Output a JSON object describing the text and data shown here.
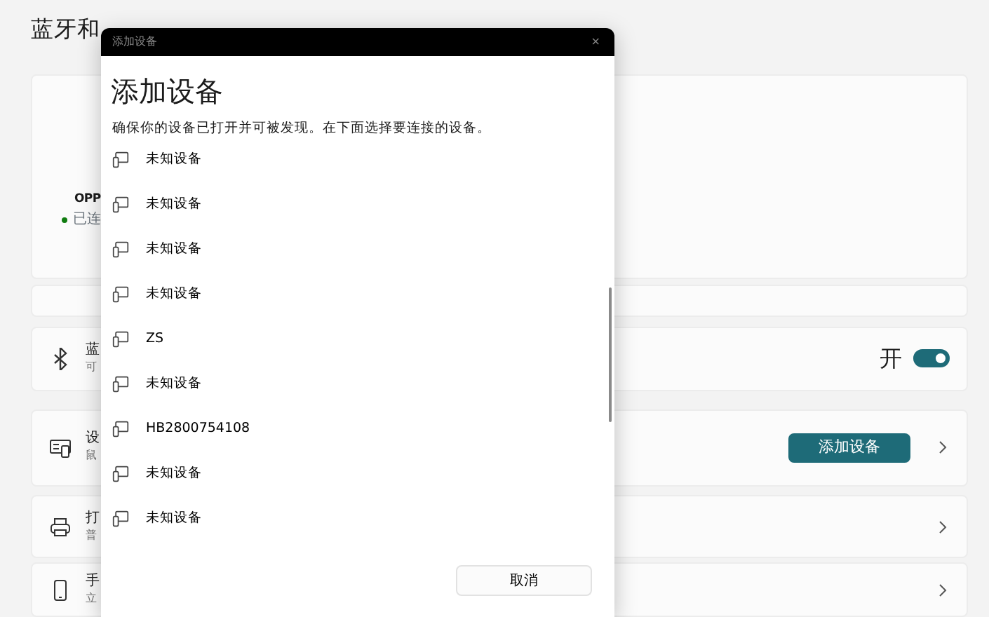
{
  "page": {
    "title": "蓝牙和",
    "connected_device": {
      "name": "OPP",
      "status": "已连"
    },
    "rows": [
      {
        "kind": "toggle",
        "title": "蓝",
        "subtitle": "可",
        "toggle_label": "开",
        "on": true
      },
      {
        "kind": "button",
        "title": "设",
        "subtitle": "鼠",
        "button": "添加设备"
      },
      {
        "kind": "link",
        "title": "打",
        "subtitle": "普"
      },
      {
        "kind": "link",
        "title": "手",
        "subtitle": "立"
      }
    ]
  },
  "dialog": {
    "window_title": "添加设备",
    "close": "×",
    "heading": "添加设备",
    "description": "确保你的设备已打开并可被发现。在下面选择要连接的设备。",
    "devices": [
      {
        "name": "未知设备"
      },
      {
        "name": "未知设备"
      },
      {
        "name": "未知设备"
      },
      {
        "name": "未知设备"
      },
      {
        "name": "ZS"
      },
      {
        "name": "未知设备"
      },
      {
        "name": "HB2800754108"
      },
      {
        "name": "未知设备"
      },
      {
        "name": "未知设备"
      }
    ],
    "cancel": "取消"
  }
}
